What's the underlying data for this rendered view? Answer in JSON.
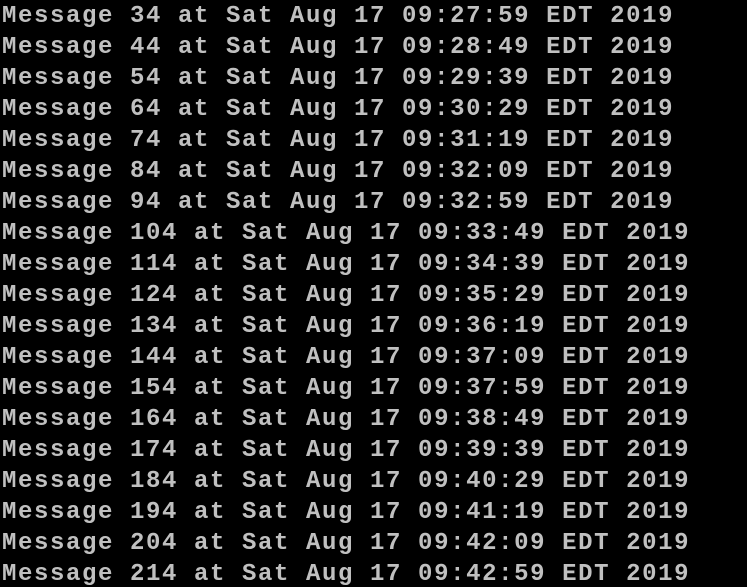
{
  "terminal": {
    "lines": [
      "Message 34 at Sat Aug 17 09:27:59 EDT 2019",
      "Message 44 at Sat Aug 17 09:28:49 EDT 2019",
      "Message 54 at Sat Aug 17 09:29:39 EDT 2019",
      "Message 64 at Sat Aug 17 09:30:29 EDT 2019",
      "Message 74 at Sat Aug 17 09:31:19 EDT 2019",
      "Message 84 at Sat Aug 17 09:32:09 EDT 2019",
      "Message 94 at Sat Aug 17 09:32:59 EDT 2019",
      "Message 104 at Sat Aug 17 09:33:49 EDT 2019",
      "Message 114 at Sat Aug 17 09:34:39 EDT 2019",
      "Message 124 at Sat Aug 17 09:35:29 EDT 2019",
      "Message 134 at Sat Aug 17 09:36:19 EDT 2019",
      "Message 144 at Sat Aug 17 09:37:09 EDT 2019",
      "Message 154 at Sat Aug 17 09:37:59 EDT 2019",
      "Message 164 at Sat Aug 17 09:38:49 EDT 2019",
      "Message 174 at Sat Aug 17 09:39:39 EDT 2019",
      "Message 184 at Sat Aug 17 09:40:29 EDT 2019",
      "Message 194 at Sat Aug 17 09:41:19 EDT 2019",
      "Message 204 at Sat Aug 17 09:42:09 EDT 2019",
      "Message 214 at Sat Aug 17 09:42:59 EDT 2019"
    ],
    "colors": {
      "background": "#000000",
      "foreground": "#c0c0c0"
    }
  }
}
